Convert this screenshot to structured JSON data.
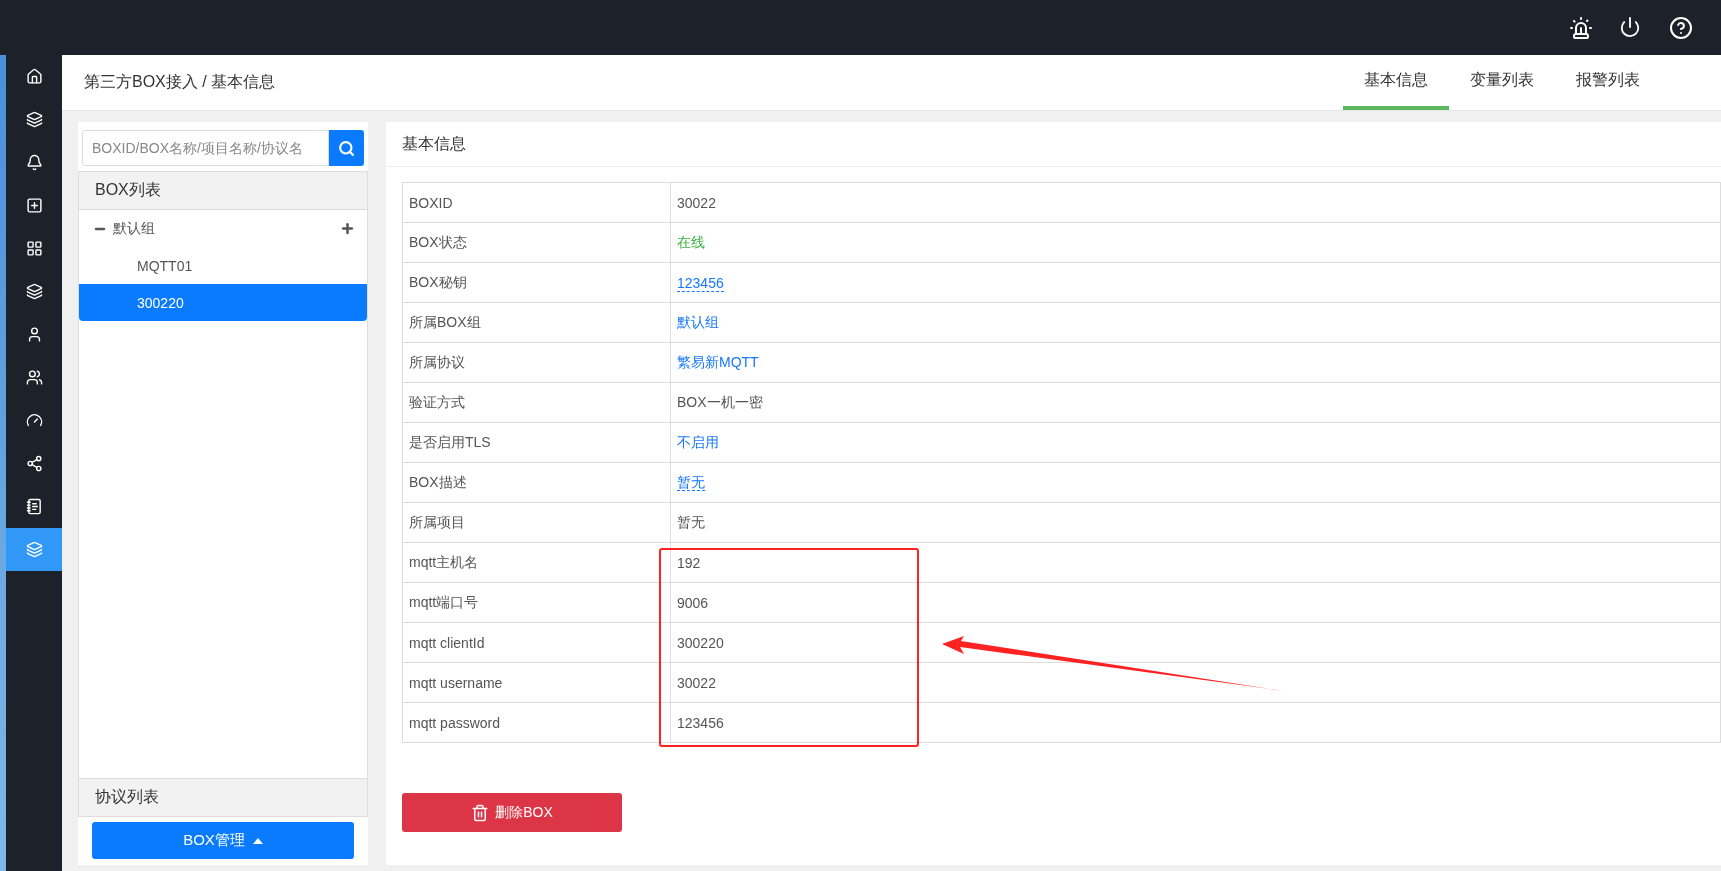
{
  "sidebar": {
    "items": [
      {
        "kind": "home",
        "selected": false
      },
      {
        "kind": "layers",
        "selected": false
      },
      {
        "kind": "bell",
        "selected": false
      },
      {
        "kind": "plus-square",
        "selected": false
      },
      {
        "kind": "grid",
        "selected": false
      },
      {
        "kind": "layers",
        "selected": false
      },
      {
        "kind": "user",
        "selected": false
      },
      {
        "kind": "users",
        "selected": false
      },
      {
        "kind": "gauge",
        "selected": false
      },
      {
        "kind": "share",
        "selected": false
      },
      {
        "kind": "notebook",
        "selected": false
      },
      {
        "kind": "layers",
        "selected": true
      }
    ]
  },
  "header": {
    "breadcrumb": "第三方BOX接入 / 基本信息",
    "tabs": [
      {
        "label": "基本信息",
        "selected": true
      },
      {
        "label": "变量列表",
        "selected": false
      },
      {
        "label": "报警列表",
        "selected": false
      }
    ]
  },
  "box_panel": {
    "search": {
      "placeholder": "BOXID/BOX名称/项目名称/协议名"
    },
    "list_title": "BOX列表",
    "group": {
      "name": "默认组",
      "expanded": true,
      "children": [
        {
          "name": "MQTT01",
          "selected": false
        },
        {
          "name": "300220",
          "selected": true
        }
      ]
    },
    "protocol_title": "协议列表",
    "manage_button": "BOX管理"
  },
  "info_card": {
    "title": "基本信息",
    "rows": [
      {
        "label": "BOXID",
        "value": "30022",
        "kind": "plain"
      },
      {
        "label": "BOX状态",
        "value": "在线",
        "kind": "status"
      },
      {
        "label": "BOX秘钥",
        "value": "123456",
        "kind": "editable"
      },
      {
        "label": "所属BOX组",
        "value": "默认组",
        "kind": "link"
      },
      {
        "label": "所属协议",
        "value": "繁易新MQTT",
        "kind": "link"
      },
      {
        "label": "验证方式",
        "value": "BOX一机一密",
        "kind": "plain"
      },
      {
        "label": "是否启用TLS",
        "value": "不启用",
        "kind": "link"
      },
      {
        "label": "BOX描述",
        "value": "暂无",
        "kind": "editable"
      },
      {
        "label": "所属项目",
        "value": "暂无",
        "kind": "plain"
      },
      {
        "label": "mqtt主机名",
        "value": "192",
        "kind": "plain"
      },
      {
        "label": "mqtt端口号",
        "value": "9006",
        "kind": "plain"
      },
      {
        "label": "mqtt clientId",
        "value": "300220",
        "kind": "plain"
      },
      {
        "label": "mqtt username",
        "value": "30022",
        "kind": "plain"
      },
      {
        "label": "mqtt password",
        "value": "123456",
        "kind": "plain"
      }
    ],
    "delete_button": "删除BOX"
  }
}
